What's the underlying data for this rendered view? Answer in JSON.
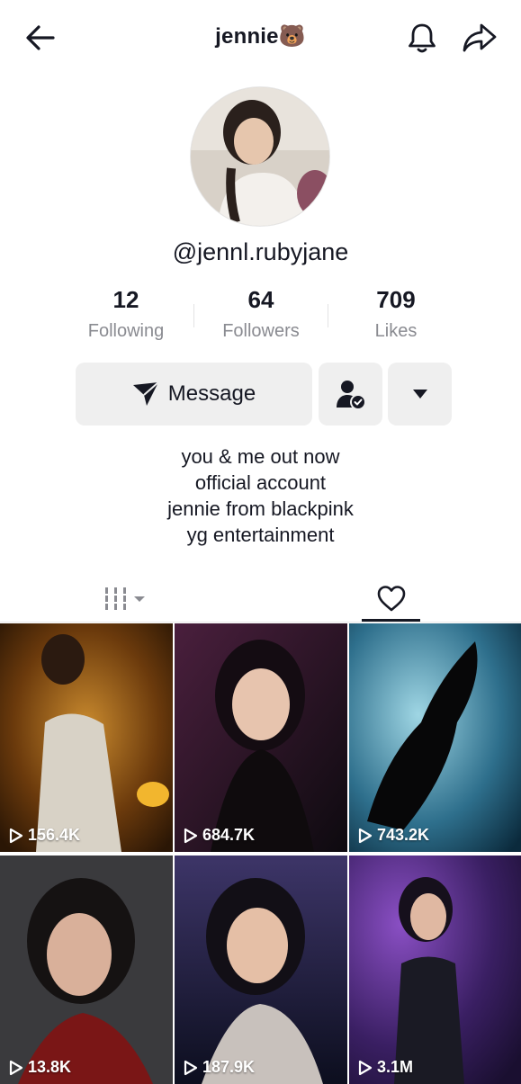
{
  "header": {
    "title": "jennie🐻",
    "back_icon": "arrow-left-icon",
    "bell_icon": "bell-icon",
    "share_icon": "share-arrow-icon"
  },
  "profile": {
    "handle": "@jennl.rubyjane",
    "stats": [
      {
        "value": "12",
        "label": "Following"
      },
      {
        "value": "64",
        "label": "Followers"
      },
      {
        "value": "709",
        "label": "Likes"
      }
    ],
    "message_label": "Message",
    "bio": [
      "you & me out now",
      "official account",
      "jennie from blackpink",
      "yg entertainment"
    ]
  },
  "tabs": {
    "active": "liked",
    "grid_icon": "videos-grid-icon",
    "liked_icon": "heart-outline-icon"
  },
  "videos": [
    {
      "views": "156.4K",
      "colors": [
        "#6b3a0c",
        "#c98a2e",
        "#3b2208"
      ]
    },
    {
      "views": "684.7K",
      "colors": [
        "#1a0f1c",
        "#4a1f3d",
        "#0d0a0f"
      ]
    },
    {
      "views": "743.2K",
      "colors": [
        "#2e6f8c",
        "#9fd6e4",
        "#0b2a3c"
      ]
    },
    {
      "views": "13.8K",
      "colors": [
        "#3a3a3d",
        "#6e5b55",
        "#1d1a1a"
      ]
    },
    {
      "views": "187.9K",
      "colors": [
        "#1b1f3a",
        "#3d3568",
        "#0c0e1e"
      ]
    },
    {
      "views": "3.1M",
      "colors": [
        "#3a1f63",
        "#8a4fc4",
        "#1a0f30"
      ]
    }
  ]
}
